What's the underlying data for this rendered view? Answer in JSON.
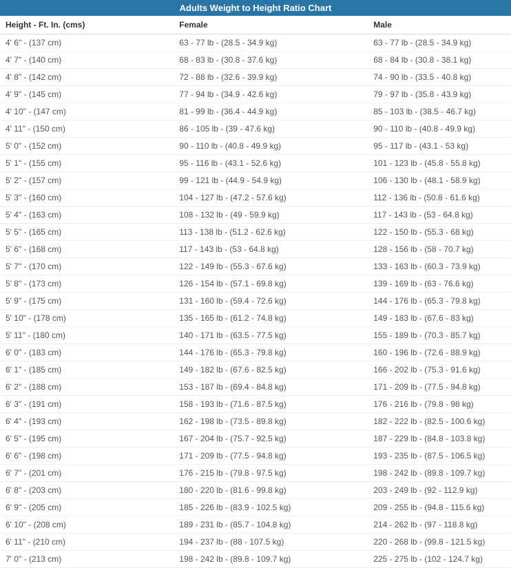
{
  "title": "Adults Weight to Height Ratio Chart",
  "headers": {
    "height": "Height - Ft. In. (cms)",
    "female": "Female",
    "male": "Male"
  },
  "rows": [
    {
      "height": "4' 6\" - (137 cm)",
      "female": "63 - 77 lb - (28.5 - 34.9 kg)",
      "male": "63 - 77 lb - (28.5 - 34.9 kg)"
    },
    {
      "height": "4' 7\" - (140 cm)",
      "female": "68 - 83 lb - (30.8 - 37.6 kg)",
      "male": "68 - 84 lb - (30.8 - 38.1 kg)"
    },
    {
      "height": "4' 8\" - (142 cm)",
      "female": "72 - 88 lb - (32.6 - 39.9 kg)",
      "male": "74 - 90 lb - (33.5 - 40.8 kg)"
    },
    {
      "height": "4' 9\" - (145 cm)",
      "female": "77 - 94 lb - (34.9 - 42.6 kg)",
      "male": "79 - 97 lb - (35.8 - 43.9 kg)"
    },
    {
      "height": "4' 10\" - (147 cm)",
      "female": "81 - 99 lb - (36.4 - 44.9 kg)",
      "male": "85 - 103 lb - (38.5 - 46.7 kg)"
    },
    {
      "height": "4' 11\" - (150 cm)",
      "female": "86 - 105 lb - (39 - 47.6 kg)",
      "male": "90 - 110 lb - (40.8 - 49.9 kg)"
    },
    {
      "height": "5' 0\" - (152 cm)",
      "female": "90 - 110 lb - (40.8 - 49.9 kg)",
      "male": "95 - 117 lb - (43.1 - 53 kg)"
    },
    {
      "height": "5' 1\" - (155 cm)",
      "female": "95 - 116 lb - (43.1 - 52.6 kg)",
      "male": "101 - 123 lb - (45.8 - 55.8 kg)"
    },
    {
      "height": "5' 2\" - (157 cm)",
      "female": "99 - 121 lb - (44.9 - 54.9 kg)",
      "male": "106 - 130 lb - (48.1 - 58.9 kg)"
    },
    {
      "height": "5' 3\" - (160 cm)",
      "female": "104 - 127 lb - (47.2 - 57.6 kg)",
      "male": "112 - 136 lb - (50.8 - 61.6 kg)"
    },
    {
      "height": "5' 4\" - (163 cm)",
      "female": "108 - 132 lb - (49 - 59.9 kg)",
      "male": "117 - 143 lb - (53 - 64.8 kg)"
    },
    {
      "height": "5' 5\" - (165 cm)",
      "female": "113 - 138 lb - (51.2 - 62.6 kg)",
      "male": "122 - 150 lb - (55.3 - 68 kg)"
    },
    {
      "height": "5' 6\" - (168 cm)",
      "female": "117 - 143 lb - (53 - 64.8 kg)",
      "male": "128 - 156 lb - (58 - 70.7 kg)"
    },
    {
      "height": "5' 7\" - (170 cm)",
      "female": "122 - 149 lb - (55.3 - 67.6 kg)",
      "male": "133 - 163 lb - (60.3 - 73.9 kg)"
    },
    {
      "height": "5' 8\" - (173 cm)",
      "female": "126 - 154 lb - (57.1 - 69.8 kg)",
      "male": "139 - 169 lb - (63 - 76.6 kg)"
    },
    {
      "height": "5' 9\" - (175 cm)",
      "female": "131 - 160 lb - (59.4 - 72.6 kg)",
      "male": "144 - 176 lb - (65.3 - 79.8 kg)"
    },
    {
      "height": "5' 10\" - (178 cm)",
      "female": "135 - 165 lb - (61.2 - 74.8 kg)",
      "male": "149 - 183 lb - (67.6 - 83 kg)"
    },
    {
      "height": "5' 11\" - (180 cm)",
      "female": "140 - 171 lb - (63.5 - 77.5 kg)",
      "male": "155 - 189 lb - (70.3 - 85.7 kg)"
    },
    {
      "height": "6' 0\" - (183 cm)",
      "female": "144 - 176 lb - (65.3 - 79.8 kg)",
      "male": "160 - 196 lb - (72.6 - 88.9 kg)"
    },
    {
      "height": "6' 1\" - (185 cm)",
      "female": "149 - 182 lb - (67.6 - 82.5 kg)",
      "male": "166 - 202 lb - (75.3 - 91.6 kg)"
    },
    {
      "height": "6' 2\" - (188 cm)",
      "female": "153 - 187 lb - (69.4 - 84.8 kg)",
      "male": "171 - 209 lb - (77.5 - 94.8 kg)"
    },
    {
      "height": "6' 3\" - (191 cm)",
      "female": "158 - 193 lb - (71.6 - 87.5 kg)",
      "male": "176 - 216 lb - (79.8 - 98 kg)"
    },
    {
      "height": "6' 4\" - (193 cm)",
      "female": "162 - 198 lb - (73.5 - 89.8 kg)",
      "male": "182 - 222 lb - (82.5 - 100.6 kg)"
    },
    {
      "height": "6' 5\" - (195 cm)",
      "female": "167 - 204 lb - (75.7 - 92.5 kg)",
      "male": "187 - 229 lb - (84.8 - 103.8 kg)"
    },
    {
      "height": "6' 6\" - (198 cm)",
      "female": "171 - 209 lb - (77.5 - 94.8 kg)",
      "male": "193 - 235 lb - (87.5 - 106.5 kg)"
    },
    {
      "height": "6' 7\" - (201 cm)",
      "female": "176 - 215 lb - (79.8 - 97.5 kg)",
      "male": "198 - 242 lb - (89.8 - 109.7 kg)"
    },
    {
      "height": "6' 8\" - (203 cm)",
      "female": "180 - 220 lb - (81.6 - 99.8 kg)",
      "male": "203 - 249 lb - (92 - 112.9 kg)"
    },
    {
      "height": "6' 9\" - (205 cm)",
      "female": "185 - 226 lb - (83.9 - 102.5 kg)",
      "male": "209 - 255 lb - (94.8 - 115.6 kg)"
    },
    {
      "height": "6' 10\" - (208 cm)",
      "female": "189 - 231 lb - (85.7 - 104.8 kg)",
      "male": "214 - 262 lb - (97 - 118.8 kg)"
    },
    {
      "height": "6' 11\" - (210 cm)",
      "female": "194 - 237 lb - (88 - 107.5 kg)",
      "male": "220 - 268 lb - (99.8 - 121.5 kg)"
    },
    {
      "height": "7' 0\" - (213 cm)",
      "female": "198 - 242 lb - (89.8 - 109.7 kg)",
      "male": "225 - 275 lb - (102 - 124.7 kg)"
    }
  ]
}
